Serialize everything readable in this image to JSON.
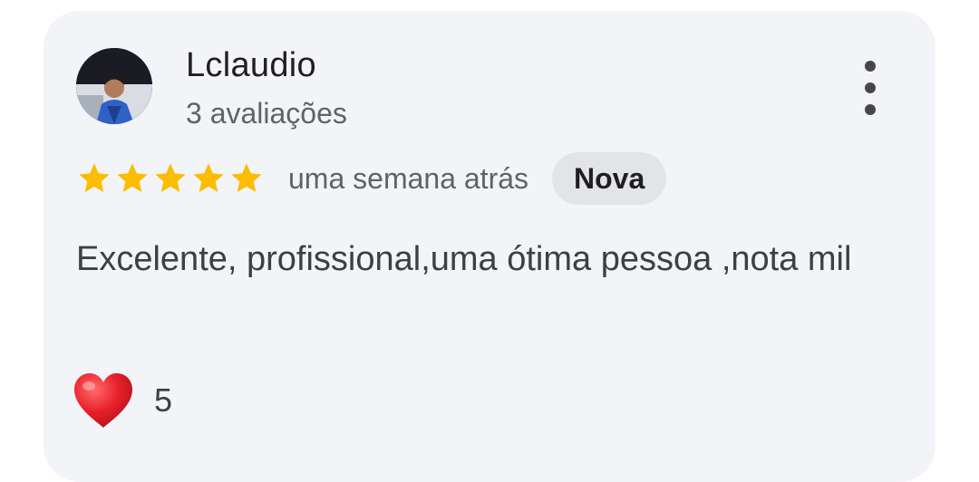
{
  "review": {
    "author": {
      "name": "Lclaudio",
      "review_count": "3 avaliações",
      "avatar_icon": "user-photo-avatar"
    },
    "rating": 5,
    "rating_max": 5,
    "time": "uma semana atrás",
    "badge": "Nova",
    "text": "Excelente, profissional,uma ótima pessoa ,nota mil",
    "reaction": {
      "icon": "heart-icon",
      "count": "5"
    },
    "more_icon": "more-vert-icon"
  },
  "colors": {
    "card_background": "#f3f4f7",
    "star": "#fbbc04",
    "badge_background": "#e2e4e8",
    "heart": "#e8202a"
  }
}
